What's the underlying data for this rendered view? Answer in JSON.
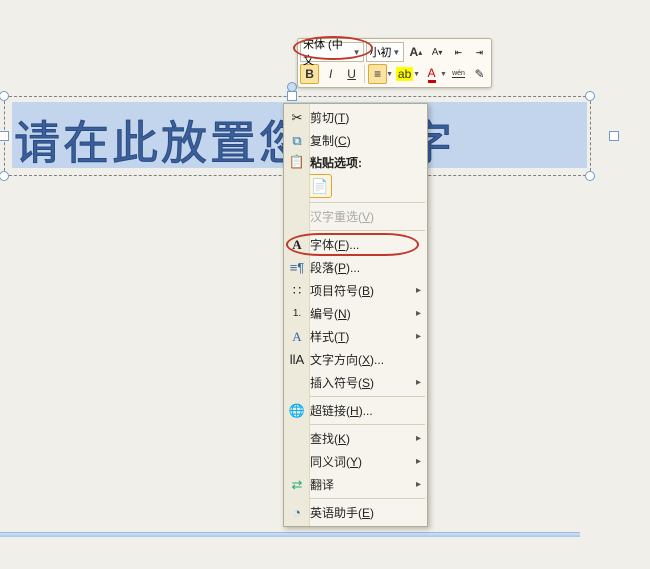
{
  "textbox": {
    "content": "请在此放置您的文字"
  },
  "toolbar": {
    "font_name": "宋体 (中文",
    "font_size": "小初",
    "grow": "A",
    "shrink": "A",
    "bold": "B",
    "italic": "I",
    "underline": "U",
    "center": "≡",
    "fontcolor": "A",
    "highlight": "ab",
    "ruby": "wén"
  },
  "menu": {
    "cut": "剪切",
    "cut_k": "T",
    "copy": "复制",
    "copy_k": "C",
    "paste_header": "粘贴选项:",
    "ime": "汉字重选",
    "ime_k": "V",
    "font": "字体",
    "font_k": "F",
    "para": "段落",
    "para_k": "P",
    "bullets": "项目符号",
    "bullets_k": "B",
    "numbering": "编号",
    "numbering_k": "N",
    "styles": "样式",
    "styles_k": "T",
    "textdir": "文字方向",
    "textdir_k": "X",
    "symbol": "插入符号",
    "symbol_k": "S",
    "hyperlink": "超链接",
    "hyperlink_k": "H",
    "find": "查找",
    "find_k": "K",
    "thesaurus": "同义词",
    "thesaurus_k": "Y",
    "translate": "翻译",
    "english": "英语助手",
    "english_k": "E"
  }
}
